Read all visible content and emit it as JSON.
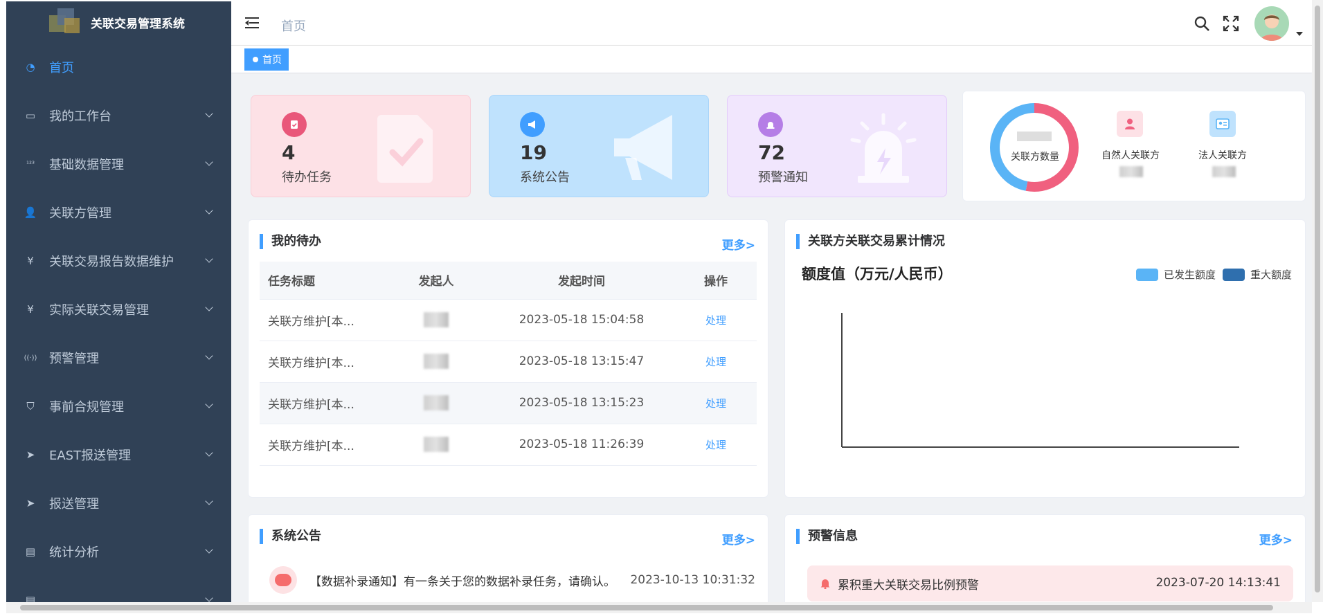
{
  "app": {
    "title": "关联交易管理系统"
  },
  "sidebar": {
    "items": [
      {
        "label": "首页",
        "icon": "dashboard-icon",
        "active": true
      },
      {
        "label": "我的工作台",
        "icon": "briefcase-icon"
      },
      {
        "label": "基础数据管理",
        "icon": "number-icon"
      },
      {
        "label": "关联方管理",
        "icon": "people-icon"
      },
      {
        "label": "关联交易报告数据维护",
        "icon": "yen-icon"
      },
      {
        "label": "实际关联交易管理",
        "icon": "yen-icon"
      },
      {
        "label": "预警管理",
        "icon": "signal-icon"
      },
      {
        "label": "事前合规管理",
        "icon": "shield-icon"
      },
      {
        "label": "EAST报送管理",
        "icon": "send-icon"
      },
      {
        "label": "报送管理",
        "icon": "send-icon"
      },
      {
        "label": "统计分析",
        "icon": "report-icon"
      },
      {
        "label": "...",
        "icon": "report-icon"
      }
    ]
  },
  "header": {
    "breadcrumb": "首页"
  },
  "tags": [
    {
      "label": "首页"
    }
  ],
  "stats": [
    {
      "value": "4",
      "label": "待办任务",
      "icon": "clipboard-check-icon",
      "color": "#e9577a",
      "bg": "#fde1e6"
    },
    {
      "value": "19",
      "label": "系统公告",
      "icon": "megaphone-icon",
      "color": "#409eff",
      "bg": "#bfe2fd"
    },
    {
      "value": "72",
      "label": "预警通知",
      "icon": "alarm-icon",
      "color": "#b57ee6",
      "bg": "#f1e6fd"
    }
  ],
  "parties": {
    "donut_center": "关联方数量",
    "natural": {
      "label": "自然人关联方"
    },
    "legal": {
      "label": "法人关联方"
    },
    "colors": {
      "natural": "#f0607f",
      "legal": "#5ab4f6"
    }
  },
  "todo": {
    "title": "我的待办",
    "more": "更多>",
    "columns": [
      "任务标题",
      "发起人",
      "发起时间",
      "操作"
    ],
    "rows": [
      {
        "title": "关联方维护[本...",
        "time": "2023-05-18 15:04:58",
        "action": "处理"
      },
      {
        "title": "关联方维护[本...",
        "time": "2023-05-18 13:15:47",
        "action": "处理"
      },
      {
        "title": "关联方维护[本...",
        "time": "2023-05-18 13:15:23",
        "action": "处理"
      },
      {
        "title": "关联方维护[本...",
        "time": "2023-05-18 11:26:39",
        "action": "处理"
      }
    ]
  },
  "chart": {
    "card_title": "关联方关联交易累计情况",
    "heading": "额度值（万元/人民币）",
    "legend": [
      {
        "name": "已发生额度",
        "color": "#5ab4f6"
      },
      {
        "name": "重大额度",
        "color": "#2f6fae"
      }
    ]
  },
  "notice": {
    "title": "系统公告",
    "more": "更多>",
    "items": [
      {
        "text": "【数据补录通知】有一条关于您的数据补录任务，请确认。",
        "time": "2023-10-13 10:31:32"
      }
    ]
  },
  "warning": {
    "title": "预警信息",
    "more": "更多>",
    "items": [
      {
        "text": "累积重大关联交易比例预警",
        "time": "2023-07-20 14:13:41"
      }
    ]
  }
}
